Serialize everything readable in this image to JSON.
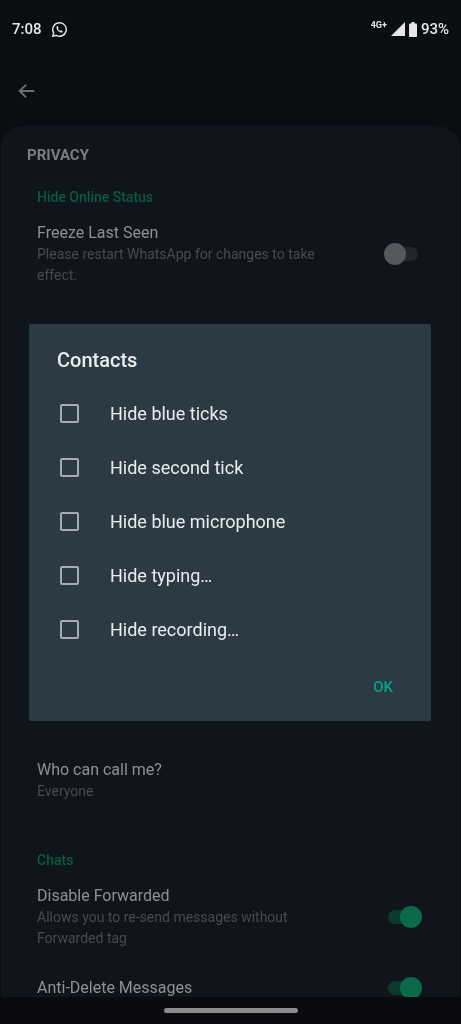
{
  "status_bar": {
    "time": "7:08",
    "network": "4G+",
    "battery": "93%"
  },
  "sheet": {
    "title": "PRIVACY",
    "sections": [
      {
        "header": "Hide Online Status",
        "items": [
          {
            "title": "Freeze Last Seen",
            "subtitle": "Please restart WhatsApp for changes to take effect.",
            "kind": "switch",
            "on": false
          }
        ]
      },
      {
        "items": [
          {
            "title": "Who can call me?",
            "subtitle": "Everyone",
            "kind": "value"
          }
        ]
      },
      {
        "header": "Chats",
        "items": [
          {
            "title": "Disable Forwarded",
            "subtitle": "Allows you to re-send messages without Forwarded tag",
            "kind": "switch",
            "on": true
          },
          {
            "title": "Anti-Delete Messages",
            "kind": "switch",
            "on": true
          }
        ]
      }
    ]
  },
  "dialog": {
    "title": "Contacts",
    "options": [
      {
        "label": "Hide blue ticks",
        "checked": false
      },
      {
        "label": "Hide second tick",
        "checked": false
      },
      {
        "label": "Hide blue microphone",
        "checked": false
      },
      {
        "label": "Hide typing…",
        "checked": false
      },
      {
        "label": "Hide recording…",
        "checked": false
      }
    ],
    "button": "OK"
  }
}
